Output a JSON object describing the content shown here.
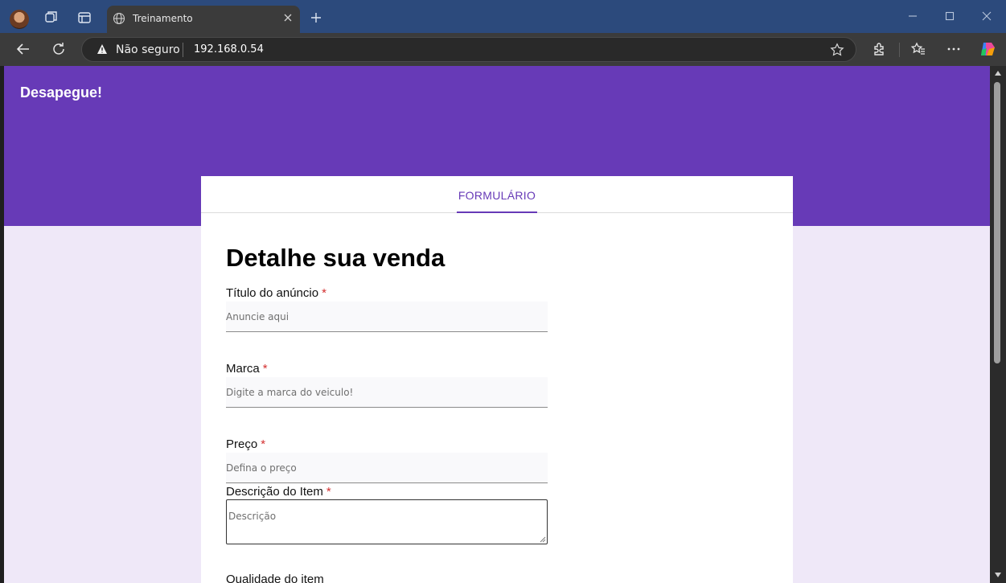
{
  "browser": {
    "tab_title": "Treinamento",
    "security_label": "Não seguro",
    "url": "192.168.0.54"
  },
  "page": {
    "brand": "Desapegue!",
    "tab_label": "FORMULÁRIO",
    "heading": "Detalhe sua venda",
    "required_mark": "*",
    "fields": [
      {
        "label": "Título do anúncio",
        "placeholder": "Anuncie aqui"
      },
      {
        "label": "Marca",
        "placeholder": "Digite a marca do veiculo!"
      },
      {
        "label": "Preço",
        "placeholder": "Defina o preço"
      },
      {
        "label": "Descrição do Item",
        "placeholder": "Descrição"
      }
    ],
    "next_label_partial": "Qualidade do item"
  },
  "colors": {
    "accent": "#673ab7",
    "page_bg": "#efe8f8",
    "required": "#d32f2f"
  }
}
